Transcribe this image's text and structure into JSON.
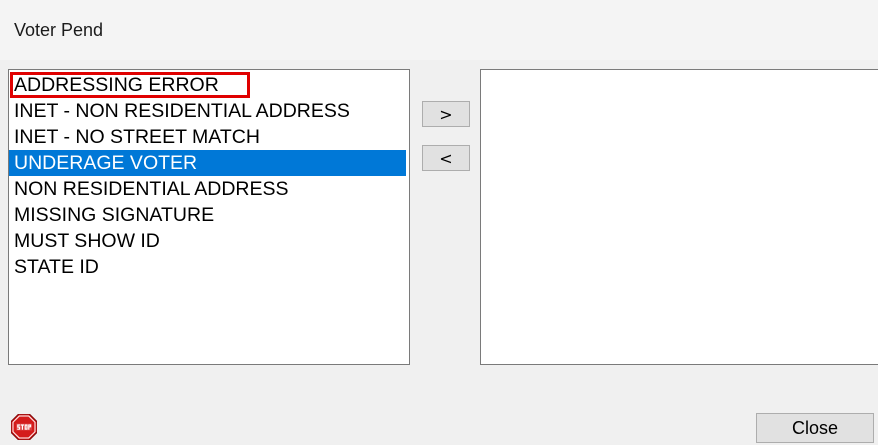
{
  "window": {
    "title": "Voter Pend"
  },
  "available_list": {
    "items": [
      {
        "label": "ADDRESSING ERROR",
        "selected": false,
        "highlighted": true
      },
      {
        "label": "INET - NON RESIDENTIAL ADDRESS",
        "selected": false,
        "highlighted": false
      },
      {
        "label": "INET - NO STREET MATCH",
        "selected": false,
        "highlighted": false
      },
      {
        "label": "UNDERAGE VOTER",
        "selected": true,
        "highlighted": false
      },
      {
        "label": "NON RESIDENTIAL ADDRESS",
        "selected": false,
        "highlighted": false
      },
      {
        "label": "MISSING SIGNATURE",
        "selected": false,
        "highlighted": false
      },
      {
        "label": "MUST SHOW ID",
        "selected": false,
        "highlighted": false
      },
      {
        "label": "STATE ID",
        "selected": false,
        "highlighted": false
      }
    ]
  },
  "selected_list": {
    "items": []
  },
  "buttons": {
    "move_right": ">",
    "move_left": "<",
    "close": "Close"
  },
  "icons": {
    "stop": "stop-sign-icon"
  },
  "colors": {
    "selection": "#0078d7",
    "highlight_border": "#e00000",
    "stop_icon": "#d41c1c"
  }
}
